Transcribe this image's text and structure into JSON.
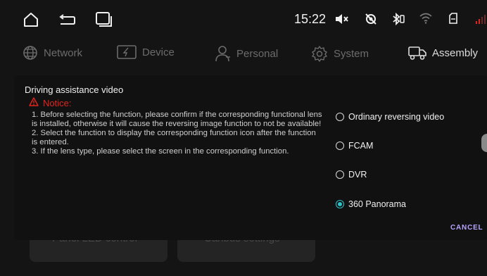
{
  "status_bar": {
    "time": "15:22",
    "icons": [
      "home-icon",
      "back-icon",
      "recents-icon",
      "mute-icon",
      "gps-icon",
      "bluetooth-icon",
      "wifi-icon",
      "sd-card-icon",
      "signal-icon"
    ]
  },
  "nav": {
    "items": [
      {
        "label": "Network",
        "icon": "globe-icon",
        "active": false
      },
      {
        "label": "Device",
        "icon": "device-icon",
        "active": false
      },
      {
        "label": "Personal",
        "icon": "person-icon",
        "active": false
      },
      {
        "label": "System",
        "icon": "gear-icon",
        "active": false
      },
      {
        "label": "Assembly",
        "icon": "truck-icon",
        "active": true
      }
    ]
  },
  "background": {
    "card_left": "Panel LED control",
    "card_right": "Canbus settings"
  },
  "dialog": {
    "title": "Driving assistance video",
    "notice_label": "Notice:",
    "notice_lines": [
      "1. Before selecting the function, please confirm if the corresponding functional lens is installed, otherwise it will cause the reversing image function to not be available!",
      "2. Select the function to display the corresponding function icon after the function is entered.",
      "3. If the lens type, please select the screen in the corresponding function."
    ],
    "options": [
      {
        "label": "Ordinary reversing video",
        "selected": false
      },
      {
        "label": "FCAM",
        "selected": false
      },
      {
        "label": "DVR",
        "selected": false
      },
      {
        "label": "360 Panorama",
        "selected": true
      }
    ],
    "cancel_label": "CANCEL"
  },
  "colors": {
    "accent": "#2ec4c9",
    "notice": "#e0261f",
    "cancel": "#b9a3ff"
  }
}
